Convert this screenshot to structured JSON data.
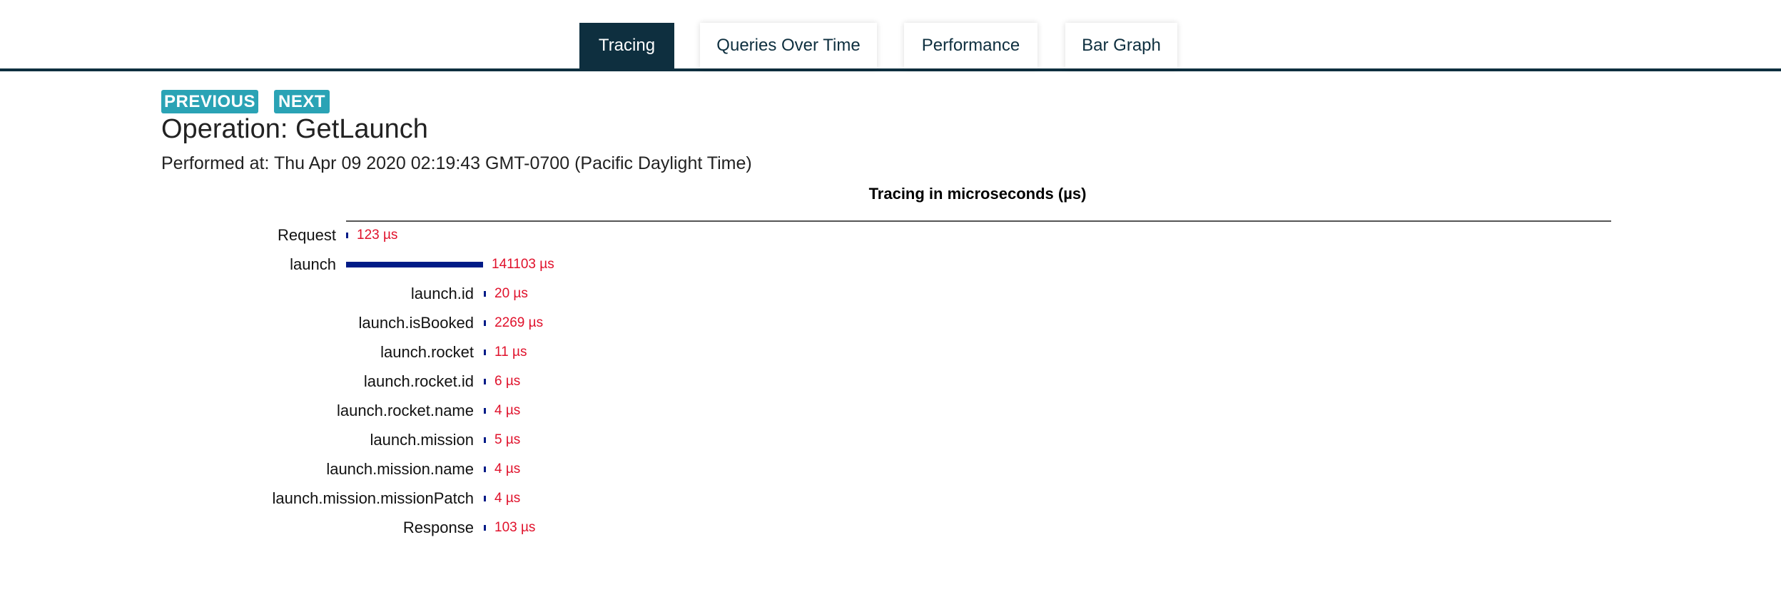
{
  "tabs": [
    {
      "label": "Tracing",
      "active": true
    },
    {
      "label": "Queries Over Time",
      "active": false
    },
    {
      "label": "Performance",
      "active": false
    },
    {
      "label": "Bar Graph",
      "active": false
    }
  ],
  "nav": {
    "previous_label": "PREVIOUS",
    "next_label": "NEXT"
  },
  "operation_title": "Operation: GetLaunch",
  "performed_at": "Performed at: Thu Apr 09 2020 02:19:43 GMT-0700 (Pacific Daylight Time)",
  "colors": {
    "accent": "#0e2f3f",
    "button": "#2aa3b5",
    "bar": "#001b87",
    "value_text": "#e0112b"
  },
  "chart_data": {
    "type": "bar",
    "title": "Tracing in microseconds (µs)",
    "unit": "µs",
    "rows": [
      {
        "label": "Request",
        "value": 123,
        "value_label": "123 µs",
        "depth": 0
      },
      {
        "label": "launch",
        "value": 141103,
        "value_label": "141103 µs",
        "depth": 0
      },
      {
        "label": "launch.id",
        "value": 20,
        "value_label": "20 µs",
        "depth": 1
      },
      {
        "label": "launch.isBooked",
        "value": 2269,
        "value_label": "2269 µs",
        "depth": 1
      },
      {
        "label": "launch.rocket",
        "value": 11,
        "value_label": "11 µs",
        "depth": 1
      },
      {
        "label": "launch.rocket.id",
        "value": 6,
        "value_label": "6 µs",
        "depth": 1
      },
      {
        "label": "launch.rocket.name",
        "value": 4,
        "value_label": "4 µs",
        "depth": 1
      },
      {
        "label": "launch.mission",
        "value": 5,
        "value_label": "5 µs",
        "depth": 1
      },
      {
        "label": "launch.mission.name",
        "value": 4,
        "value_label": "4 µs",
        "depth": 1
      },
      {
        "label": "launch.mission.missionPatch",
        "value": 4,
        "value_label": "4 µs",
        "depth": 1
      },
      {
        "label": "Response",
        "value": 103,
        "value_label": "103 µs",
        "depth": 1
      }
    ]
  }
}
